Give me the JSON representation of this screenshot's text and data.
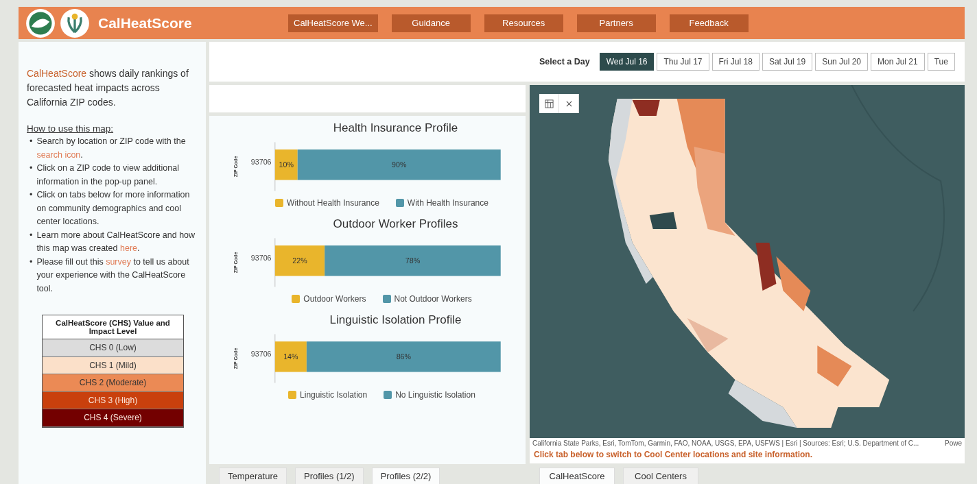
{
  "header": {
    "app_name": "CalHeatScore",
    "nav": [
      "CalHeatScore We...",
      "Guidance",
      "Resources",
      "Partners",
      "Feedback"
    ]
  },
  "sidebar": {
    "intro": {
      "brand": "CalHeatScore",
      "text": " shows daily rankings of forecasted heat impacts across California ZIP codes."
    },
    "howto_title": "How to use this map:",
    "steps": [
      {
        "marker": "•",
        "parts": [
          {
            "kind": "text",
            "text": "Search by location or ZIP code with the "
          },
          {
            "kind": "link",
            "text": "search icon"
          },
          {
            "kind": "text",
            "text": "."
          }
        ]
      },
      {
        "marker": "•",
        "parts": [
          {
            "kind": "text",
            "text": "Click on a ZIP code to view additional information in the pop-up panel."
          }
        ]
      },
      {
        "marker": "•",
        "parts": [
          {
            "kind": "text",
            "text": "Click on tabs below for more information on community demographics and cool center locations."
          }
        ]
      },
      {
        "marker": "•",
        "parts": [
          {
            "kind": "text",
            "text": "Learn more about CalHeatScore and how this map was created "
          },
          {
            "kind": "link",
            "text": "here"
          },
          {
            "kind": "text",
            "text": "."
          }
        ]
      },
      {
        "marker": "•",
        "parts": [
          {
            "kind": "text",
            "text": "Please fill out this "
          },
          {
            "kind": "link",
            "text": "survey"
          },
          {
            "kind": "text",
            "text": " to tell us about your experience with the CalHeatScore tool."
          }
        ]
      }
    ],
    "legend": {
      "title": "CalHeatScore (CHS) Value and Impact Level",
      "levels": [
        {
          "label": "CHS 0 (Low)",
          "color": "#dcdcdc"
        },
        {
          "label": "CHS 1 (Mild)",
          "color": "#fbe0c9"
        },
        {
          "label": "CHS 2 (Moderate)",
          "color": "#eb8a55"
        },
        {
          "label": "CHS 3 (High)",
          "color": "#c9400d"
        },
        {
          "label": "CHS 4 (Severe)",
          "color": "#730000"
        }
      ]
    }
  },
  "day_selector": {
    "label": "Select a Day",
    "days": [
      {
        "label": "Wed Jul 16",
        "selected": true
      },
      {
        "label": "Thu Jul 17",
        "selected": false
      },
      {
        "label": "Fri Jul 18",
        "selected": false
      },
      {
        "label": "Sat Jul 19",
        "selected": false
      },
      {
        "label": "Sun Jul 20",
        "selected": false
      },
      {
        "label": "Mon Jul 21",
        "selected": false
      },
      {
        "label": "Tue",
        "selected": false
      }
    ]
  },
  "profiles": [
    {
      "chart_data": {
        "type": "bar",
        "title": "Health Insurance Profile",
        "ylabel": "ZIP Code",
        "categories": [
          "93706"
        ],
        "orientation": "horizontal",
        "stacked": true,
        "series": [
          {
            "name": "Without Health Insurance",
            "color": "#e9b52c",
            "values": [
              10
            ],
            "value_labels": [
              "10%"
            ]
          },
          {
            "name": "With Health Insurance",
            "color": "#5296a8",
            "values": [
              90
            ],
            "value_labels": [
              "90%"
            ]
          }
        ]
      }
    },
    {
      "chart_data": {
        "type": "bar",
        "title": "Outdoor Worker Profiles",
        "ylabel": "ZIP Code",
        "categories": [
          "93706"
        ],
        "orientation": "horizontal",
        "stacked": true,
        "series": [
          {
            "name": "Outdoor Workers",
            "color": "#e9b52c",
            "values": [
              22
            ],
            "value_labels": [
              "22%"
            ]
          },
          {
            "name": "Not Outdoor Workers",
            "color": "#5296a8",
            "values": [
              78
            ],
            "value_labels": [
              "78%"
            ]
          }
        ]
      }
    },
    {
      "chart_data": {
        "type": "bar",
        "title": "Linguistic Isolation Profile",
        "ylabel": "ZIP Code",
        "categories": [
          "93706"
        ],
        "orientation": "horizontal",
        "stacked": true,
        "series": [
          {
            "name": "Linguistic Isolation",
            "color": "#e9b52c",
            "values": [
              14
            ],
            "value_labels": [
              "14%"
            ]
          },
          {
            "name": "No Linguistic Isolation",
            "color": "#5296a8",
            "values": [
              86
            ],
            "value_labels": [
              "86%"
            ]
          }
        ]
      }
    }
  ],
  "profile_tabs": [
    {
      "label": "Temperature",
      "selected": false
    },
    {
      "label": "Profiles (1/2)",
      "selected": false
    },
    {
      "label": "Profiles (2/2)",
      "selected": true
    }
  ],
  "map": {
    "kind": "picture",
    "attribution": "California State Parks, Esri, TomTom, Garmin, FAO, NOAA, USGS, EPA, USFWS | Esri | Sources: Esri; U.S. Department of C...",
    "powered": "Powe",
    "note": "Click tab below to switch to Cool Center locations and site information."
  },
  "map_tabs": [
    {
      "label": "CalHeatScore",
      "selected": true
    },
    {
      "label": "Cool Centers",
      "selected": false
    }
  ]
}
